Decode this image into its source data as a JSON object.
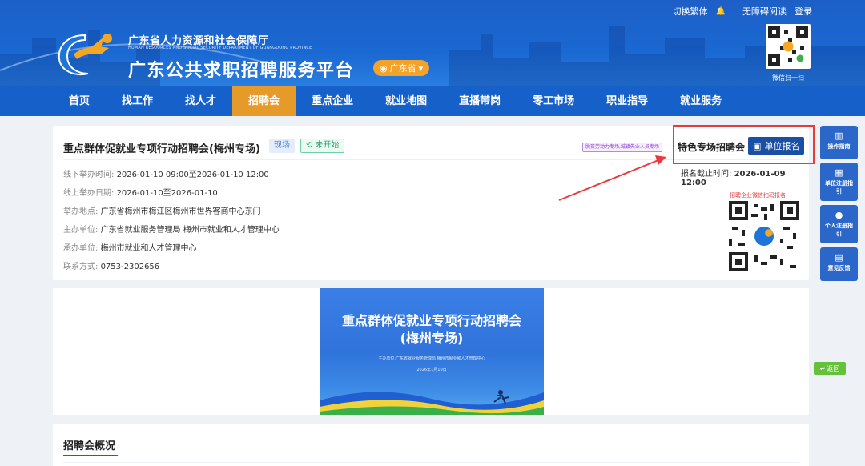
{
  "header": {
    "topbar": {
      "traditional": "切换繁体",
      "accessible": "无障碍阅读",
      "login": "登录"
    },
    "org_cn": "广东省人力资源和社会保障厅",
    "org_en": "HUMAN RESOURCES AND SOCIAL SECURITY DEPARTMENT OF GUANGDONG PROVINCE",
    "platform": "广东公共求职招聘服务平台",
    "province": "广东省",
    "qr_label": "微信扫一扫"
  },
  "nav": {
    "items": [
      {
        "label": "首页"
      },
      {
        "label": "找工作"
      },
      {
        "label": "找人才"
      },
      {
        "label": "招聘会",
        "active": true
      },
      {
        "label": "重点企业"
      },
      {
        "label": "就业地图"
      },
      {
        "label": "直播带岗"
      },
      {
        "label": "零工市场"
      },
      {
        "label": "职业指导"
      },
      {
        "label": "就业服务"
      }
    ]
  },
  "event": {
    "title": "重点群体促就业专项行动招聘会(梅州专场)",
    "tag_type": "现场",
    "tag_status": "未开始",
    "special_badge": "脱贫劳动力专场,城镇失业人员专场",
    "special_label": "特色专场招聘会",
    "apply_button": "单位报名",
    "deadline_label": "报名截止时间:",
    "deadline_value": "2026-01-09 12:00",
    "qr_caption": "招聘企业微信扫码报名",
    "offline_time_label": "线下举办时间:",
    "offline_time": "2026-01-10 09:00至2026-01-10 12:00",
    "online_date_label": "线上举办日期:",
    "online_date": "2026-01-10至2026-01-10",
    "venue_label": "举办地点:",
    "venue": "广东省梅州市梅江区梅州市世界客商中心东门",
    "host_label": "主办单位:",
    "host": "广东省就业服务管理局 梅州市就业和人才管理中心",
    "organizer_label": "承办单位:",
    "organizer": "梅州市就业和人才管理中心",
    "contact_label": "联系方式:",
    "contact": "0753-2302656"
  },
  "side_tools": [
    {
      "label": "操作指南",
      "icon": "book-icon"
    },
    {
      "label": "单位注册指引",
      "icon": "building-icon"
    },
    {
      "label": "个人注册指引",
      "icon": "person-icon"
    },
    {
      "label": "意见反馈",
      "icon": "feedback-icon"
    }
  ],
  "back_button": "返回",
  "banner": {
    "title_line1": "重点群体促就业专项行动招聘会",
    "title_line2": "(梅州专场)",
    "host_text": "主办单位:广东省就业服务管理局 梅州市就业和人才管理中心",
    "date_text": "2026年1月10日"
  },
  "overview": {
    "title": "招聘会概况"
  },
  "colors": {
    "header_blue": "#1a68d2",
    "nav_active": "#e69a2a",
    "apply_button": "#1b4fa6",
    "annotation_red": "#e8393d",
    "side_tool": "#2b67c9"
  }
}
